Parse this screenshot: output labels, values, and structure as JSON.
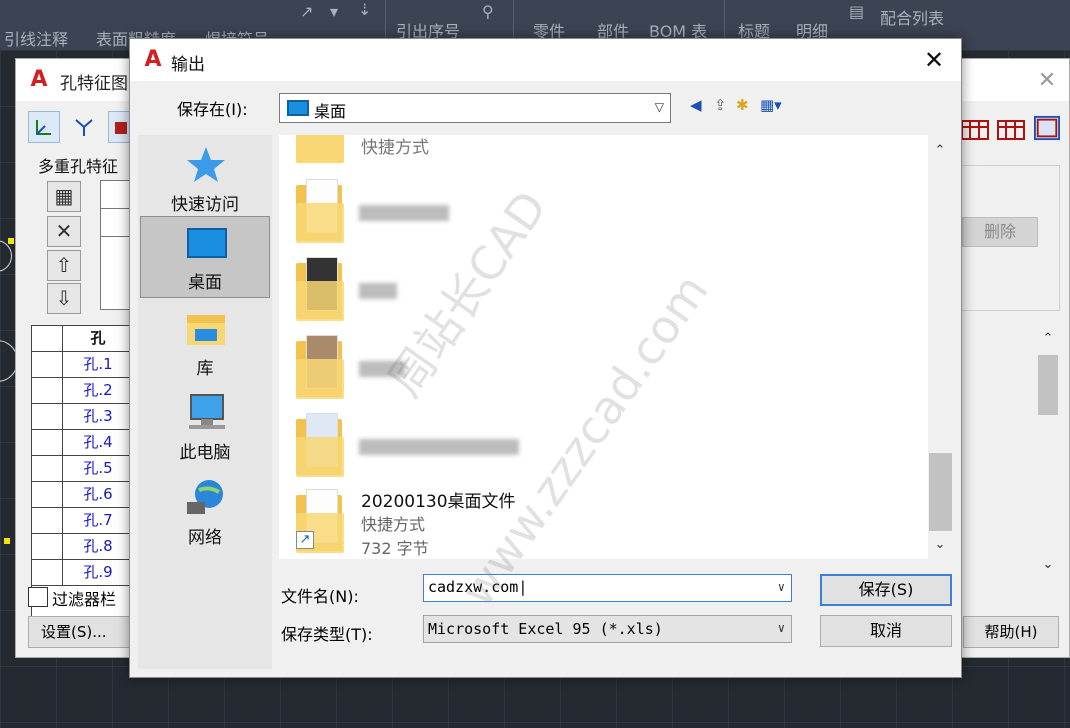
{
  "ribbon": {
    "panels": [
      "引线注释",
      "表面粗糙度",
      "焊接符号",
      "引出序号",
      "零件",
      "部件",
      "BOM 表",
      "标题",
      "明细",
      "配合列表"
    ]
  },
  "hole_dialog": {
    "title": "孔特征图",
    "group_label": "多重孔特征",
    "table_header": "孔",
    "rows": [
      "孔.1",
      "孔.2",
      "孔.3",
      "孔.4",
      "孔.5",
      "孔.6",
      "孔.7",
      "孔.8",
      "孔.9"
    ],
    "delete_label": "删除",
    "filter_label": "过滤器栏",
    "settings_label": "设置(S)...",
    "help_label": "帮助(H)"
  },
  "save_dialog": {
    "title": "输出",
    "save_in_label": "保存在(I):",
    "save_in_value": "桌面",
    "places": [
      {
        "label": "快速访问",
        "icon": "star-icon",
        "active": false
      },
      {
        "label": "桌面",
        "icon": "desktop-icon",
        "active": true
      },
      {
        "label": "库",
        "icon": "library-icon",
        "active": false
      },
      {
        "label": "此电脑",
        "icon": "computer-icon",
        "active": false
      },
      {
        "label": "网络",
        "icon": "network-icon",
        "active": false
      }
    ],
    "files": {
      "partial_top": "快捷方式",
      "shortcut_name": "20200130桌面文件",
      "shortcut_type": "快捷方式",
      "shortcut_size": "732 字节"
    },
    "filename_label": "文件名(N):",
    "filename_value": "cadzxw.com",
    "filetype_label": "保存类型(T):",
    "filetype_value": "Microsoft Excel 95 (*.xls)",
    "save_label": "保存(S)",
    "cancel_label": "取消"
  },
  "watermark": {
    "line1": "周站长CAD",
    "line2": "zzzcad.com",
    "line3": "www."
  },
  "colors": {
    "accent": "#3c7fd6",
    "folder": "#f1c24d",
    "hole_row_text": "#1818c8"
  }
}
